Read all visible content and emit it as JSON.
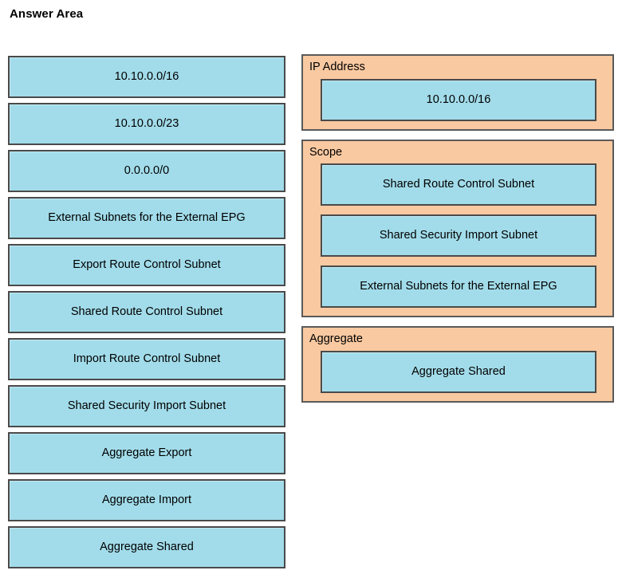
{
  "page": {
    "title": "Answer Area",
    "background_color": "#ffffff"
  },
  "colors": {
    "tile_fill": "#a2dcea",
    "tile_border": "#4a4a4a",
    "panel_fill": "#f9c9a1",
    "panel_border": "#5a5a5a",
    "text": "#000000"
  },
  "source_list": {
    "name": "draggable-options",
    "items": [
      {
        "label": "10.10.0.0/16"
      },
      {
        "label": "10.10.0.0/23"
      },
      {
        "label": "0.0.0.0/0"
      },
      {
        "label": "External Subnets for the External EPG"
      },
      {
        "label": "Export Route Control Subnet"
      },
      {
        "label": "Shared Route Control Subnet"
      },
      {
        "label": "Import Route Control Subnet"
      },
      {
        "label": "Shared Security Import Subnet"
      },
      {
        "label": "Aggregate Export"
      },
      {
        "label": "Aggregate Import"
      },
      {
        "label": "Aggregate Shared"
      }
    ]
  },
  "target_panels": [
    {
      "label": "IP Address",
      "items": [
        {
          "label": "10.10.0.0/16"
        }
      ]
    },
    {
      "label": "Scope",
      "items": [
        {
          "label": "Shared Route Control Subnet"
        },
        {
          "label": "Shared Security Import Subnet"
        },
        {
          "label": "External Subnets for the External EPG"
        }
      ]
    },
    {
      "label": "Aggregate",
      "items": [
        {
          "label": "Aggregate Shared"
        }
      ]
    }
  ]
}
